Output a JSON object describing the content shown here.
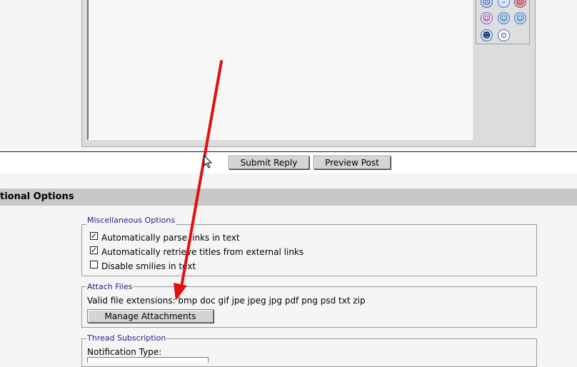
{
  "smilies": [
    {
      "name": "sad-smiley-icon",
      "glyph": "☹",
      "color": "#c8d6ff"
    },
    {
      "name": "neutral-smiley-icon",
      "glyph": "–",
      "color": "#d6e8ff"
    },
    {
      "name": "mad-smiley-icon",
      "glyph": "☹",
      "color": "#ff9a9a"
    },
    {
      "name": "tongue-smiley-icon",
      "glyph": "☺",
      "color": "#ffd6f0"
    },
    {
      "name": "smile-smiley-icon",
      "glyph": "☺",
      "color": "#bfe4ff"
    },
    {
      "name": "wink-smiley-icon",
      "glyph": "☺",
      "color": "#bfe4ff"
    },
    {
      "name": "cool-smiley-icon",
      "glyph": "☻",
      "color": "#bfe4ff"
    },
    {
      "name": "shocked-smiley-icon",
      "glyph": "⊙",
      "color": "#ffffff"
    }
  ],
  "buttons": {
    "submit_reply": "Submit Reply",
    "preview_post": "Preview Post"
  },
  "options_section": {
    "title": "tional Options"
  },
  "misc_options": {
    "legend": "Miscellaneous Options",
    "items": [
      {
        "label": "Automatically parse links in text",
        "checked": true
      },
      {
        "label": "Automatically retrieve titles from external links",
        "checked": true
      },
      {
        "label": "Disable smilies in text",
        "checked": false
      }
    ]
  },
  "attach_files": {
    "legend": "Attach Files",
    "extensions_text": "Valid file extensions: bmp doc gif jpe jpeg jpg pdf png psd txt zip",
    "manage_button": "Manage Attachments"
  },
  "thread_subscription": {
    "legend": "Thread Subscription",
    "notification_label": "Notification Type:"
  },
  "colors": {
    "arrow": "#e01010"
  }
}
